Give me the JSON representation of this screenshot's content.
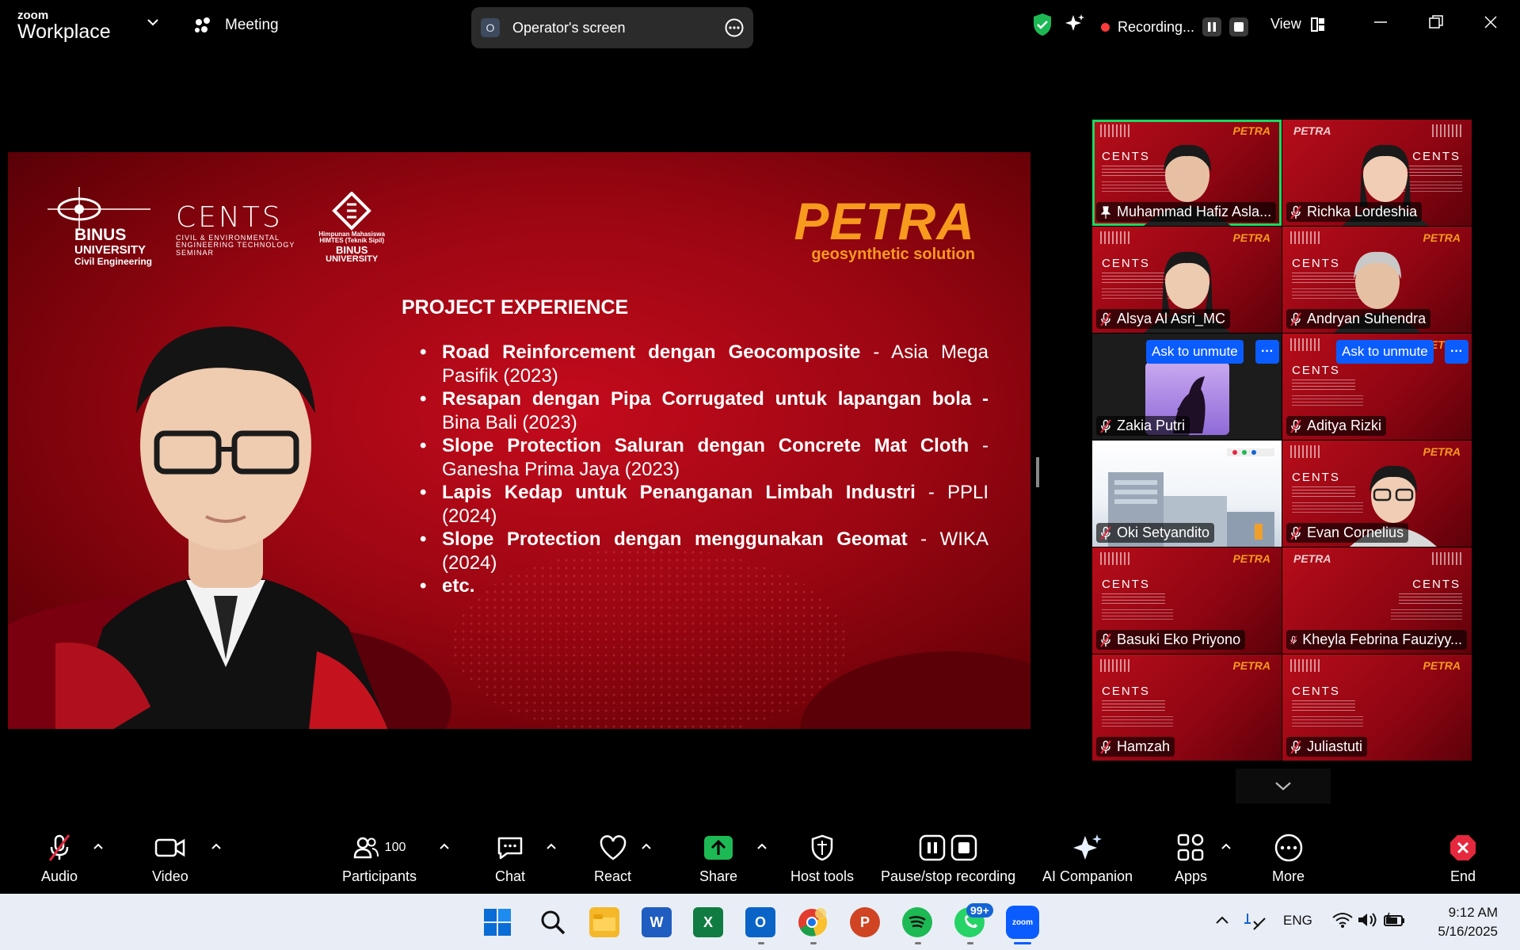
{
  "app": {
    "brand_small": "zoom",
    "brand_name": "Workplace",
    "meeting_label": "Meeting"
  },
  "operator": {
    "initial": "O",
    "label": "Operator's screen"
  },
  "recording": {
    "label": "Recording..."
  },
  "view_label": "View",
  "slide": {
    "logos": {
      "binus_1": "BINUS",
      "binus_2": "UNIVERSITY",
      "binus_3": "Civil Engineering",
      "cents": "CENTS",
      "cents_sub": "CIVIL & ENVIRONMENTAL\nENGINEERING TECHNOLOGY\nSEMINAR",
      "himtes_1": "Himpunan Mahasiswa\nHIMTES (Teknik Sipil)",
      "himtes_2": "BINUS",
      "himtes_3": "UNIVERSITY"
    },
    "petra_title": "PETRA",
    "petra_sub": "geosynthetic solution",
    "section_title": "PROJECT EXPERIENCE",
    "projects": [
      {
        "bold": "Road Reinforcement dengan Geocomposite",
        "rest": " - Asia Mega Pasifik (2023)"
      },
      {
        "bold": "Resapan dengan Pipa Corrugated untuk lapangan bola -",
        "rest": " Bina Bali (2023)"
      },
      {
        "bold": "Slope Protection Saluran dengan Concrete Mat Cloth",
        "rest": " - Ganesha Prima Jaya (2023)"
      },
      {
        "bold": "Lapis Kedap untuk Penanganan Limbah Industri",
        "rest": " - PPLI (2024)"
      },
      {
        "bold": "Slope Protection dengan menggunakan Geomat",
        "rest": " - WIKA (2024)"
      },
      {
        "bold": "etc.",
        "rest": ""
      }
    ]
  },
  "participants": [
    {
      "name": "Muhammad Hafiz Asla...",
      "type": "video"
    },
    {
      "name": "Richka Lordeshia",
      "type": "video"
    },
    {
      "name": "Alsya Al Asri_MC",
      "type": "video"
    },
    {
      "name": "Andryan Suhendra",
      "type": "video"
    },
    {
      "name": "Zakia Putri",
      "type": "avatar"
    },
    {
      "name": "Aditya Rizki",
      "type": "video"
    },
    {
      "name": "Oki Setyandito",
      "type": "image"
    },
    {
      "name": "Evan Cornelius",
      "type": "video"
    },
    {
      "name": "Basuki Eko Priyono",
      "type": "video"
    },
    {
      "name": "Kheyla Febrina Fauziyy...",
      "type": "video"
    },
    {
      "name": "Hamzah",
      "type": "video"
    },
    {
      "name": "Juliastuti",
      "type": "video"
    }
  ],
  "tile_text": {
    "cents": "CENTS",
    "petra": "PETRA"
  },
  "ask_to_unmute": "Ask to unmute",
  "toolbar": {
    "audio": "Audio",
    "video": "Video",
    "participants": "Participants",
    "participants_count": "100",
    "chat": "Chat",
    "react": "React",
    "share": "Share",
    "host_tools": "Host tools",
    "pause_stop": "Pause/stop recording",
    "ai_companion": "AI Companion",
    "apps": "Apps",
    "more": "More",
    "end": "End"
  },
  "taskbar": {
    "whatsapp_badge": "99+",
    "lang": "ENG",
    "time": "9:12 AM",
    "date": "5/16/2025",
    "word": "W",
    "excel": "X",
    "outlook": "O",
    "powerpoint": "P",
    "zoom": "zoom"
  },
  "colors": {
    "accent_green": "#1ed760",
    "zoom_blue": "#0b5cff",
    "petra_orange": "#f79a1e",
    "slide_red": "#9b0612",
    "end_red": "#e5283d"
  }
}
